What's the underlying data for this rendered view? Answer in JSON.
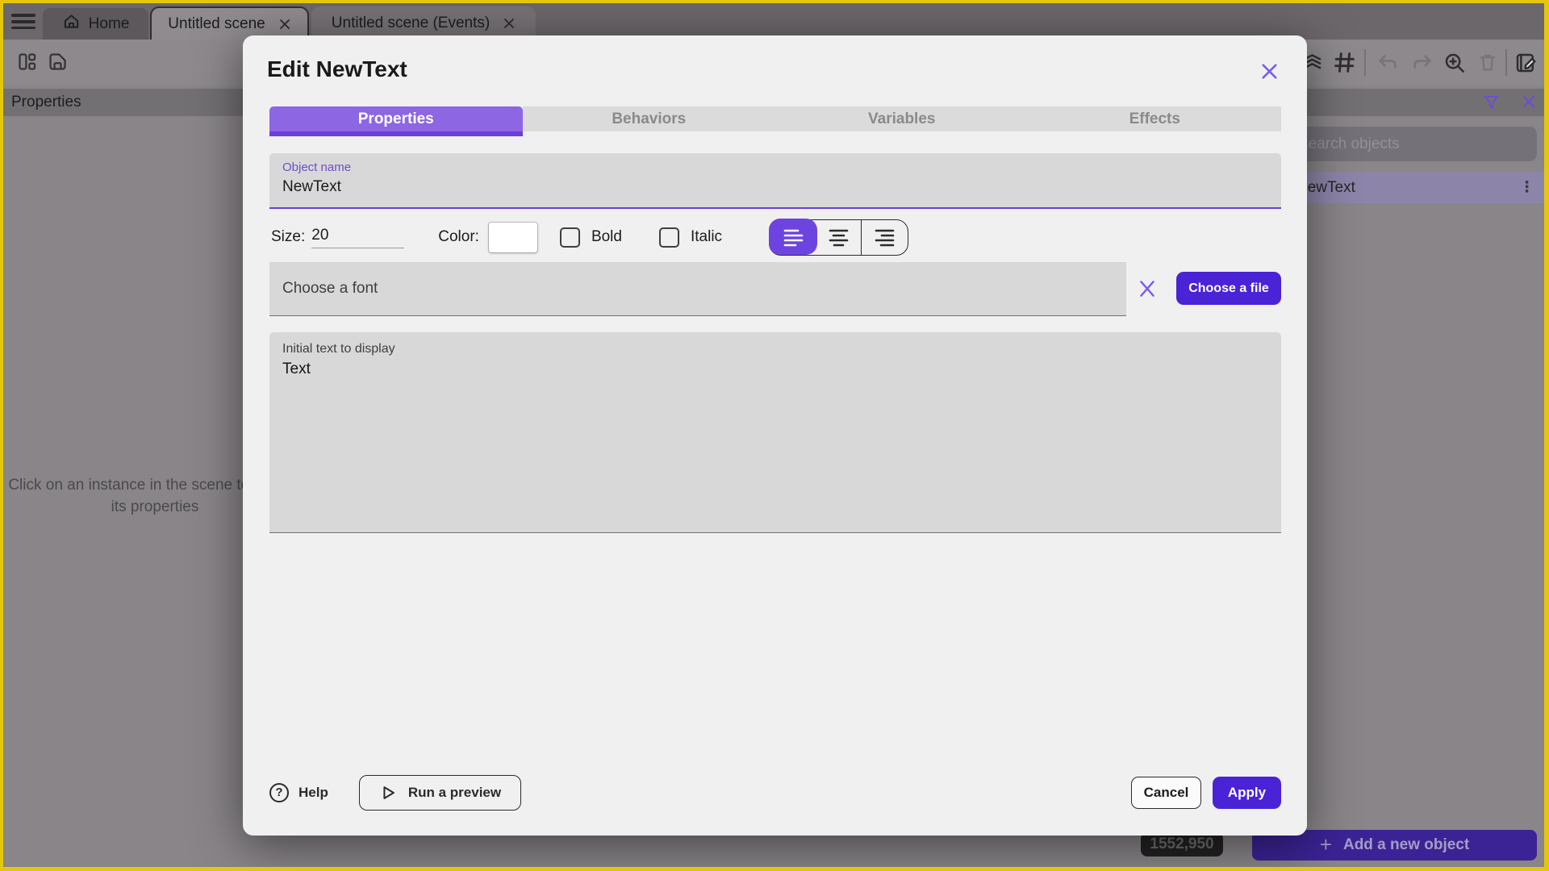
{
  "chrome": {
    "tabs": {
      "home": "Home",
      "scene": "Untitled scene",
      "events": "Untitled scene (Events)"
    }
  },
  "panels": {
    "properties_header": "Properties",
    "properties_empty": "Click on an instance in the scene to display its properties",
    "objects": {
      "search_placeholder": "Search objects",
      "item": "NewText",
      "add_button": "Add a new object",
      "coordinates": "1552,950"
    }
  },
  "modal": {
    "title": "Edit NewText",
    "tabs": [
      "Properties",
      "Behaviors",
      "Variables",
      "Effects"
    ],
    "active_tab": "Properties",
    "object_name_label": "Object name",
    "object_name_value": "NewText",
    "size_label": "Size:",
    "size_value": "20",
    "color_label": "Color:",
    "color_value": "#000000",
    "bold_label": "Bold",
    "bold_checked": false,
    "italic_label": "Italic",
    "italic_checked": false,
    "alignment_selected": "left",
    "font_placeholder": "Choose a font",
    "font_button": "Choose a file",
    "text_label": "Initial text to display",
    "text_value": "Text",
    "help": "Help",
    "run_preview": "Run a preview",
    "cancel": "Cancel",
    "apply": "Apply"
  },
  "icons": {
    "plus": "+",
    "kebab": "⋮",
    "help": "?"
  },
  "colors": {
    "accent_purple": "#6c40da",
    "tab_active_purple": "#8c66e3",
    "button_indigo": "#4a23d6",
    "frame_yellow": "#e5c60e",
    "swatch_black": "#050505"
  }
}
